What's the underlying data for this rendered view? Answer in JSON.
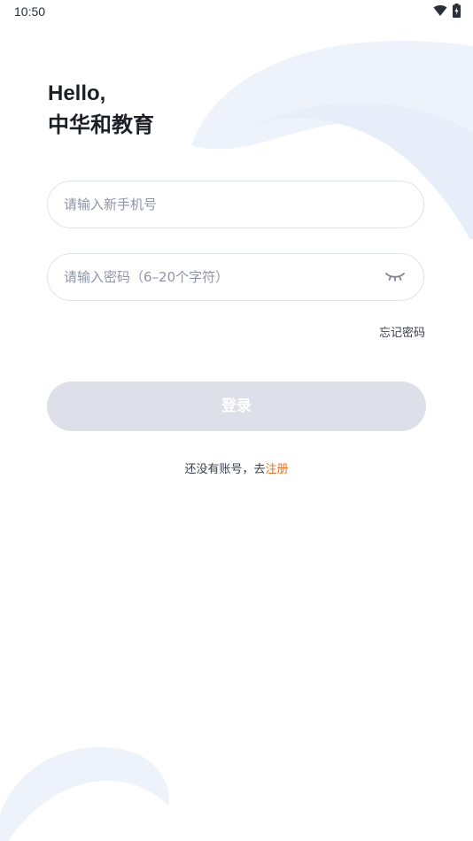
{
  "status_bar": {
    "time": "10:50",
    "icons": [
      "wifi-icon",
      "battery-icon"
    ]
  },
  "greeting": {
    "line1": "Hello,",
    "line2": "中华和教育"
  },
  "form": {
    "phone_placeholder": "请输入新手机号",
    "password_placeholder": "请输入密码（6–20个字符）",
    "forgot_label": "忘记密码",
    "login_label": "登录",
    "register_prompt": "还没有账号，去",
    "register_link": "注册"
  },
  "colors": {
    "accent": "#f26a1b",
    "button_disabled": "#dde0e8",
    "decoration": "#eef3fb"
  }
}
